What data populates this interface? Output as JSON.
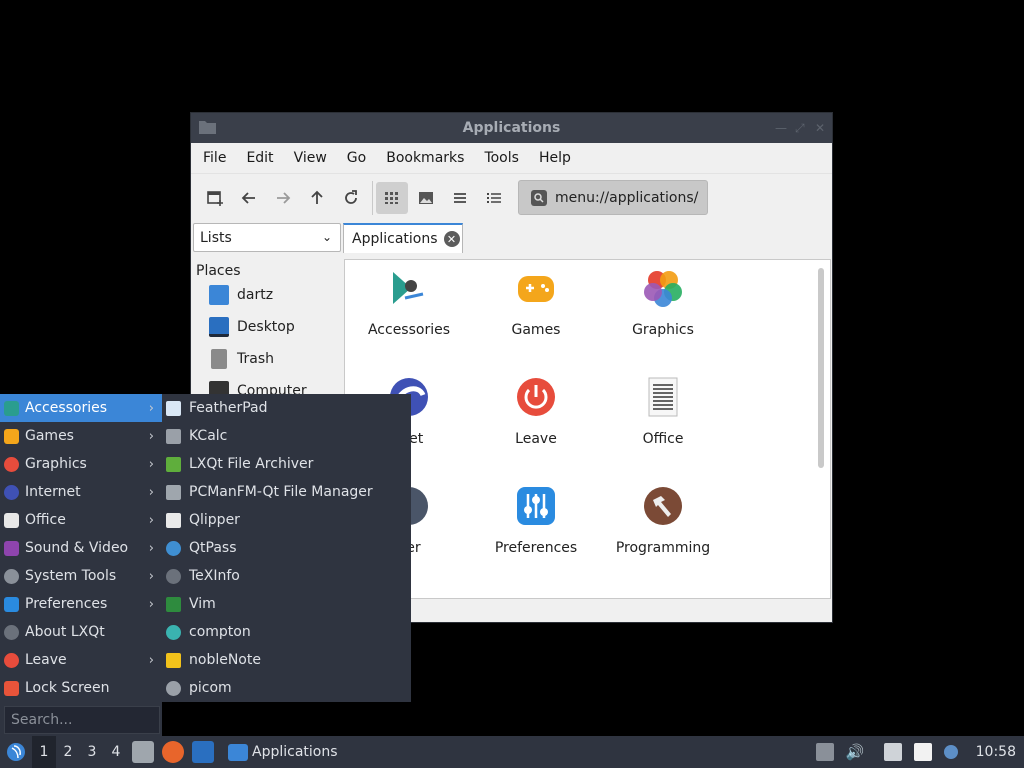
{
  "window": {
    "title": "Applications",
    "menubar": [
      "File",
      "Edit",
      "View",
      "Go",
      "Bookmarks",
      "Tools",
      "Help"
    ],
    "path": "menu://applications/",
    "side_pane_mode": "Lists",
    "tab_label": "Applications",
    "places_header": "Places",
    "places": [
      "dartz",
      "Desktop",
      "Trash",
      "Computer"
    ],
    "apps": [
      {
        "label": "Accessories",
        "icon": "accessories-icon"
      },
      {
        "label": "Games",
        "icon": "games-icon"
      },
      {
        "label": "Graphics",
        "icon": "graphics-icon"
      },
      {
        "label": "Internet",
        "icon": "internet-icon"
      },
      {
        "label": "Leave",
        "icon": "leave-icon"
      },
      {
        "label": "Office",
        "icon": "office-icon"
      },
      {
        "label": "Other",
        "icon": "other-icon"
      },
      {
        "label": "Preferences",
        "icon": "preferences-icon"
      },
      {
        "label": "Programming",
        "icon": "programming-icon"
      }
    ],
    "apps_visible": [
      "Accessories",
      "Games",
      "Graphics",
      "rnet",
      "Leave",
      "Office",
      "her",
      "Preferences",
      "Programming"
    ]
  },
  "start_menu": {
    "items": [
      {
        "label": "Accessories",
        "has_submenu": true,
        "selected": true
      },
      {
        "label": "Games",
        "has_submenu": true
      },
      {
        "label": "Graphics",
        "has_submenu": true
      },
      {
        "label": "Internet",
        "has_submenu": true
      },
      {
        "label": "Office",
        "has_submenu": true
      },
      {
        "label": "Sound & Video",
        "has_submenu": true
      },
      {
        "label": "System Tools",
        "has_submenu": true
      },
      {
        "label": "Preferences",
        "has_submenu": true
      },
      {
        "label": "About LXQt",
        "has_submenu": false
      },
      {
        "label": "Leave",
        "has_submenu": true
      },
      {
        "label": "Lock Screen",
        "has_submenu": false
      }
    ],
    "search_placeholder": "Search...",
    "submenu_items": [
      "FeatherPad",
      "KCalc",
      "LXQt File Archiver",
      "PCManFM-Qt File Manager",
      "Qlipper",
      "QtPass",
      "TeXInfo",
      "Vim",
      "compton",
      "nobleNote",
      "picom"
    ]
  },
  "taskbar": {
    "workspaces": [
      "1",
      "2",
      "3",
      "4"
    ],
    "active_workspace": "1",
    "task_label": "Applications",
    "clock": "10:58"
  }
}
